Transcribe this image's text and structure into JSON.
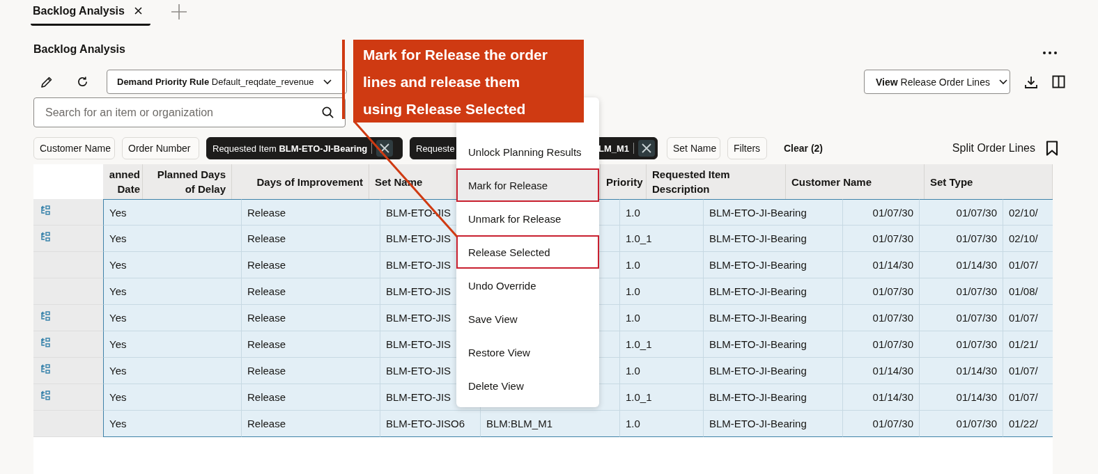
{
  "tabs": [
    {
      "label": "Backlog Analysis",
      "selected": true
    }
  ],
  "page_title": "Backlog Analysis",
  "rule_dropdown": {
    "label": "Demand Priority Rule",
    "value": "Default_reqdate_revenue"
  },
  "view_dropdown": {
    "label": "View",
    "value": "Release Order Lines"
  },
  "search": {
    "placeholder": "Search for an item or organization"
  },
  "filter_chips": [
    {
      "kind": "button",
      "label": "Customer Name"
    },
    {
      "kind": "button",
      "label": "Order Number"
    },
    {
      "kind": "applied",
      "label": "Requested Item",
      "value": "BLM-ETO-JI-Bearing"
    },
    {
      "kind": "applied_partial",
      "label": "Requeste",
      "value": "LM_M1"
    },
    {
      "kind": "button",
      "label": "Set Name"
    },
    {
      "kind": "button",
      "label": "Filters"
    }
  ],
  "clear_filters": "Clear (2)",
  "split_order_lines": "Split Order Lines",
  "table": {
    "header_labels": [
      "anned Date",
      "Planned Days of Delay",
      "Days of Improvement",
      "Set Name",
      "Priority",
      "Requested Item Description",
      "Customer Name",
      "Set Type"
    ],
    "rows": [
      {
        "selected": true,
        "split": true,
        "cells": [
          "Yes",
          "Release",
          "BLM-ETO-JIS",
          null,
          "1.0",
          "BLM-ETO-JI-Bearing",
          "01/07/30",
          "01/07/30",
          "02/10/"
        ]
      },
      {
        "selected": true,
        "split": true,
        "cells": [
          "Yes",
          "Release",
          "BLM-ETO-JIS",
          null,
          "1.0_1",
          "BLM-ETO-JI-Bearing",
          "01/07/30",
          "01/07/30",
          "02/10/"
        ]
      },
      {
        "selected": true,
        "split": false,
        "cells": [
          "Yes",
          "Release",
          "BLM-ETO-JIS",
          null,
          "1.0",
          "BLM-ETO-JI-Bearing",
          "01/14/30",
          "01/14/30",
          "01/07/"
        ]
      },
      {
        "selected": true,
        "split": false,
        "cells": [
          "Yes",
          "Release",
          "BLM-ETO-JIS",
          null,
          "1.0",
          "BLM-ETO-JI-Bearing",
          "01/07/30",
          "01/07/30",
          "01/08/"
        ]
      },
      {
        "selected": true,
        "split": true,
        "cells": [
          "Yes",
          "Release",
          "BLM-ETO-JIS",
          null,
          "1.0",
          "BLM-ETO-JI-Bearing",
          "01/07/30",
          "01/07/30",
          "01/07/"
        ]
      },
      {
        "selected": true,
        "split": true,
        "cells": [
          "Yes",
          "Release",
          "BLM-ETO-JIS",
          null,
          "1.0_1",
          "BLM-ETO-JI-Bearing",
          "01/07/30",
          "01/07/30",
          "01/21/"
        ]
      },
      {
        "selected": true,
        "split": true,
        "cells": [
          "Yes",
          "Release",
          "BLM-ETO-JIS",
          null,
          "1.0",
          "BLM-ETO-JI-Bearing",
          "01/14/30",
          "01/14/30",
          "01/07/"
        ]
      },
      {
        "selected": true,
        "split": true,
        "cells": [
          "Yes",
          "Release",
          "BLM-ETO-JIS",
          null,
          "1.0_1",
          "BLM-ETO-JI-Bearing",
          "01/14/30",
          "01/14/30",
          "01/07/"
        ]
      },
      {
        "selected": true,
        "split": false,
        "cells": [
          "Yes",
          "Release",
          "BLM-ETO-JISO6",
          "BLM:BLM_M1",
          "1.0",
          "BLM-ETO-JI-Bearing",
          "01/07/30",
          "01/07/30",
          "01/22/"
        ]
      }
    ]
  },
  "context_menu": {
    "items": [
      {
        "label": "Unlock Planning Results",
        "hovered": false,
        "highlighted": false
      },
      {
        "label": "Mark for Release",
        "hovered": true,
        "highlighted": true
      },
      {
        "label": "Unmark for Release",
        "hovered": false,
        "highlighted": false
      },
      {
        "label": "Release Selected",
        "hovered": false,
        "highlighted": true
      },
      {
        "label": "Undo Override",
        "hovered": false,
        "highlighted": false
      },
      {
        "label": "Save View",
        "hovered": false,
        "highlighted": false
      },
      {
        "label": "Restore View",
        "hovered": false,
        "highlighted": false
      },
      {
        "label": "Delete View",
        "hovered": false,
        "highlighted": false
      }
    ]
  },
  "callout": {
    "text": "Mark for Release the order lines and release them using Release Selected"
  }
}
